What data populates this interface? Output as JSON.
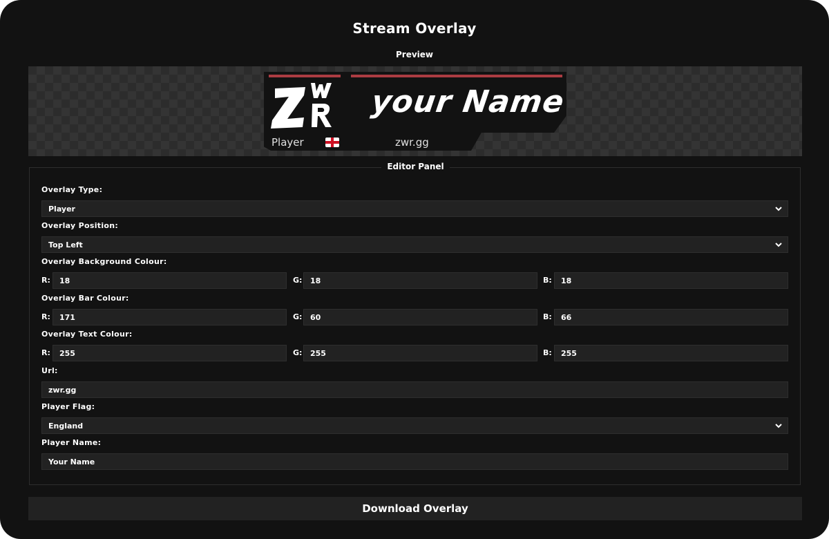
{
  "title": "Stream Overlay",
  "preview": {
    "label": "Preview",
    "overlay": {
      "logo_text": "ZWR",
      "name": "your Name",
      "player_label": "Player",
      "url": "zwr.gg",
      "flag": "england-flag-icon",
      "bar_color": "#ab3c42",
      "background_color": "#121212"
    }
  },
  "editor": {
    "legend": "Editor Panel",
    "overlay_type": {
      "label": "Overlay Type:",
      "value": "Player"
    },
    "overlay_position": {
      "label": "Overlay Position:",
      "value": "Top Left"
    },
    "background_colour": {
      "label": "Overlay Background Colour:",
      "r": "18",
      "g": "18",
      "b": "18"
    },
    "bar_colour": {
      "label": "Overlay Bar Colour:",
      "r": "171",
      "g": "60",
      "b": "66"
    },
    "text_colour": {
      "label": "Overlay Text Colour:",
      "r": "255",
      "g": "255",
      "b": "255"
    },
    "url": {
      "label": "Url:",
      "value": "zwr.gg"
    },
    "player_flag": {
      "label": "Player Flag:",
      "value": "England"
    },
    "player_name": {
      "label": "Player Name:",
      "value": "Your Name"
    },
    "rgb_labels": {
      "r": "R:",
      "g": "G:",
      "b": "B:"
    }
  },
  "download_label": "Download Overlay"
}
